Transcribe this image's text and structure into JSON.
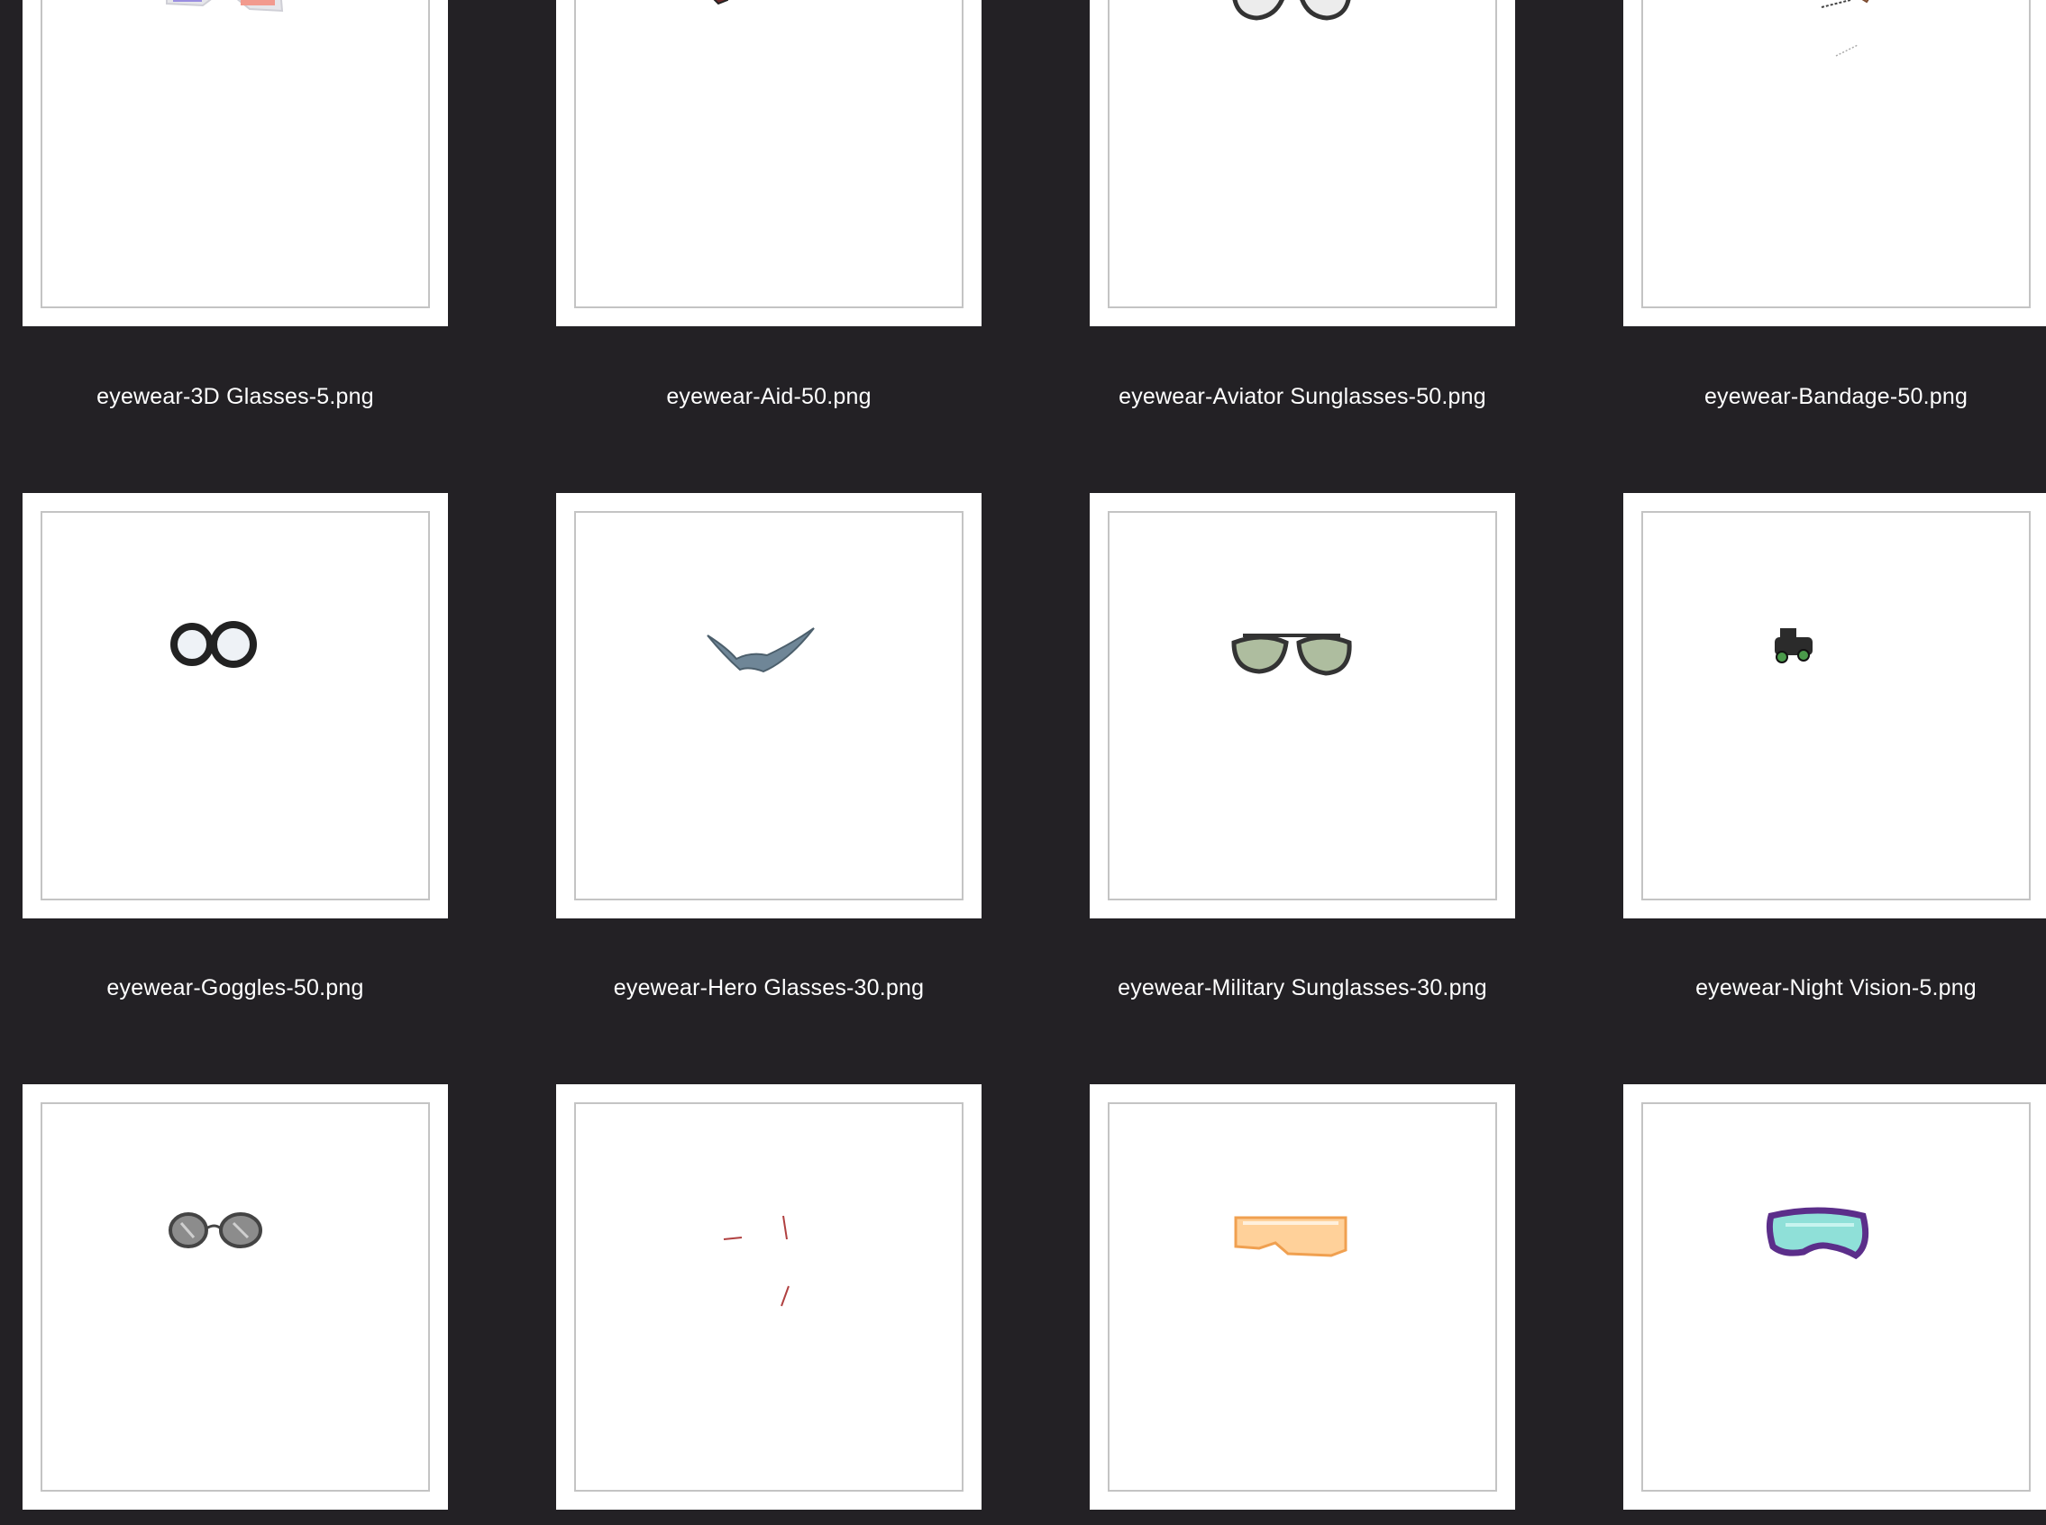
{
  "files": [
    {
      "name": "eyewear-3D Glasses-5.png",
      "icon": "3d-glasses-icon"
    },
    {
      "name": "eyewear-Aid-50.png",
      "icon": "aid-stitches-icon"
    },
    {
      "name": "eyewear-Aviator Sunglasses-50.png",
      "icon": "aviator-sunglasses-icon"
    },
    {
      "name": "eyewear-Bandage-50.png",
      "icon": "bandage-icon"
    },
    {
      "name": "eyewear-Goggles-50.png",
      "icon": "goggles-icon"
    },
    {
      "name": "eyewear-Hero Glasses-30.png",
      "icon": "hero-glasses-icon"
    },
    {
      "name": "eyewear-Military Sunglasses-30.png",
      "icon": "military-sunglasses-icon"
    },
    {
      "name": "eyewear-Night Vision-5.png",
      "icon": "night-vision-icon"
    },
    {
      "name": "",
      "icon": "round-sunglasses-icon"
    },
    {
      "name": "",
      "icon": "scar-stitches-icon"
    },
    {
      "name": "",
      "icon": "ski-visor-icon"
    },
    {
      "name": "",
      "icon": "diving-mask-icon"
    }
  ]
}
